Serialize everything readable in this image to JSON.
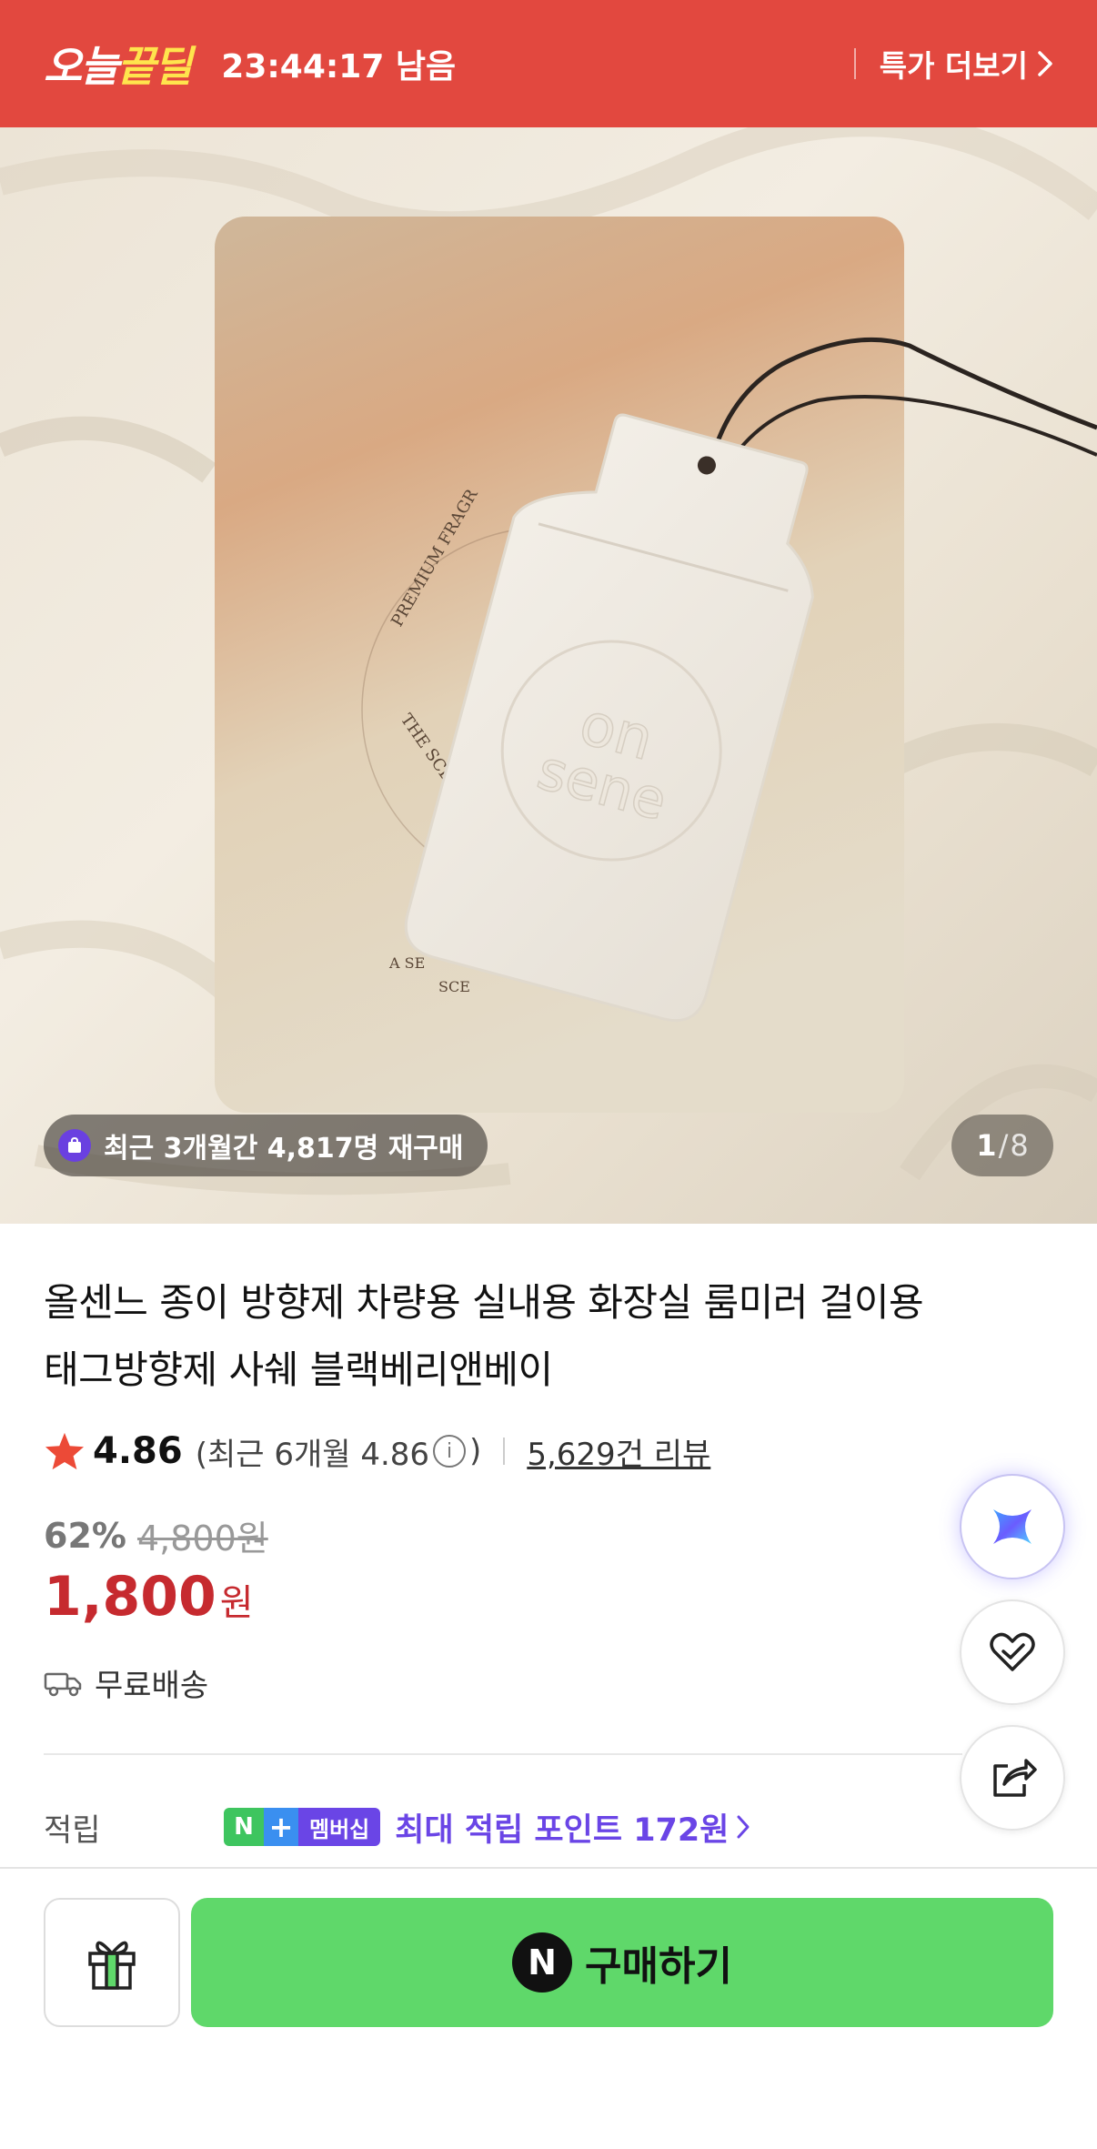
{
  "deal_bar": {
    "logo_main": "오늘",
    "logo_accent": "끝딜",
    "timer": "23:44:17 남음",
    "more_label": "특가 더보기"
  },
  "hero": {
    "repurchase": "최근 3개월간 4,817명 재구매",
    "counter_current": "1",
    "counter_sep": "/",
    "counter_total": "8",
    "package_curve_text": "PREMIUM FRAGR",
    "package_lower_text": "THE SCE",
    "package_bottom_line1": "A SE",
    "package_bottom_line2": "SCE",
    "tag_logo_line1": "on",
    "tag_logo_line2": "sene"
  },
  "product": {
    "title_line1": "올센느 종이 방향제 차량용 실내용 화장실 룸미러 걸이용",
    "title_line2": "태그방향제 사쉐 블랙베리앤베이",
    "rating": "4.86",
    "recent_prefix": "(최근 6개월 4.86",
    "recent_suffix": ")",
    "reviews": "5,629건 리뷰",
    "discount": "62%",
    "original_price": "4,800원",
    "price": "1,800",
    "price_unit": "원",
    "shipping": "무료배송"
  },
  "points": {
    "label": "적립",
    "badge_n": "N",
    "badge_plus": "+",
    "badge_membership": "멤버십",
    "link": "최대 적립 포인트 172원"
  },
  "bottom": {
    "buy_icon": "N",
    "buy_label": "구매하기"
  },
  "colors": {
    "deal_red": "#e2483f",
    "price_red": "#c62a2f",
    "buy_green": "#5fd86a",
    "membership_purple": "#6a45e6"
  },
  "icons": [
    "chevron-right-icon",
    "shopping-bag-icon",
    "star-icon",
    "info-icon",
    "truck-icon",
    "ai-assistant-icon",
    "heart-check-icon",
    "share-icon",
    "gift-icon",
    "naver-n-icon"
  ]
}
